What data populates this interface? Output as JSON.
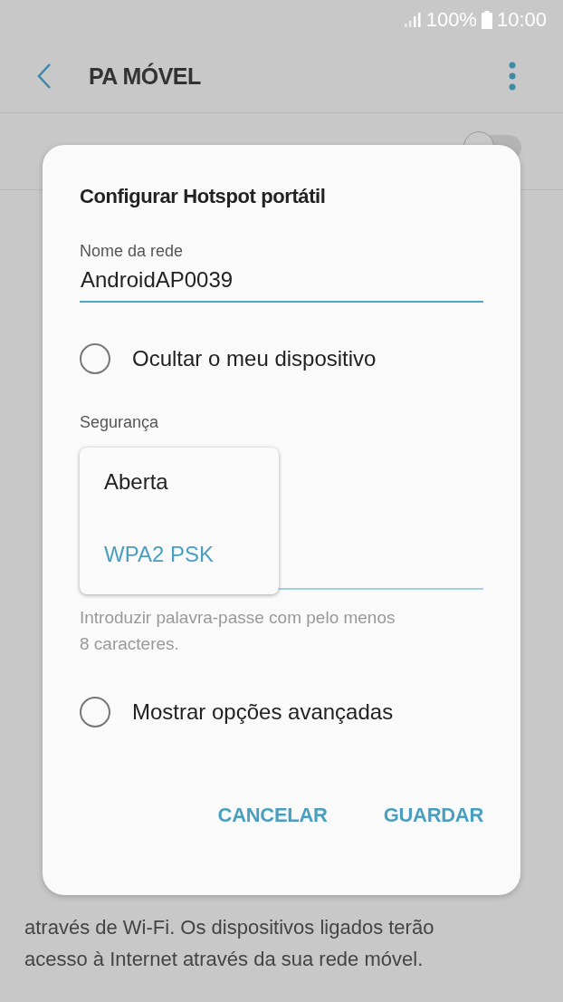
{
  "status_bar": {
    "battery": "100%",
    "time": "10:00"
  },
  "app_bar": {
    "title": "PA MÓVEL"
  },
  "background": {
    "toggle_on": false,
    "paragraph": "através de Wi-Fi. Os dispositivos ligados terão\nacesso à Internet através da sua rede móvel."
  },
  "dialog": {
    "title": "Configurar Hotspot portátil",
    "network_name": {
      "label": "Nome da rede",
      "value": "AndroidAP0039"
    },
    "hide_device": {
      "label": "Ocultar o meu dispositivo",
      "checked": false
    },
    "security": {
      "label": "Segurança",
      "options": [
        {
          "label": "Aberta",
          "selected": false
        },
        {
          "label": "WPA2 PSK",
          "selected": true
        }
      ]
    },
    "password": {
      "hint": "Introduzir palavra-passe com pelo menos\n8 caracteres."
    },
    "advanced": {
      "label": "Mostrar opções avançadas",
      "checked": false
    },
    "buttons": [
      "CANCELAR",
      "GUARDAR"
    ]
  }
}
